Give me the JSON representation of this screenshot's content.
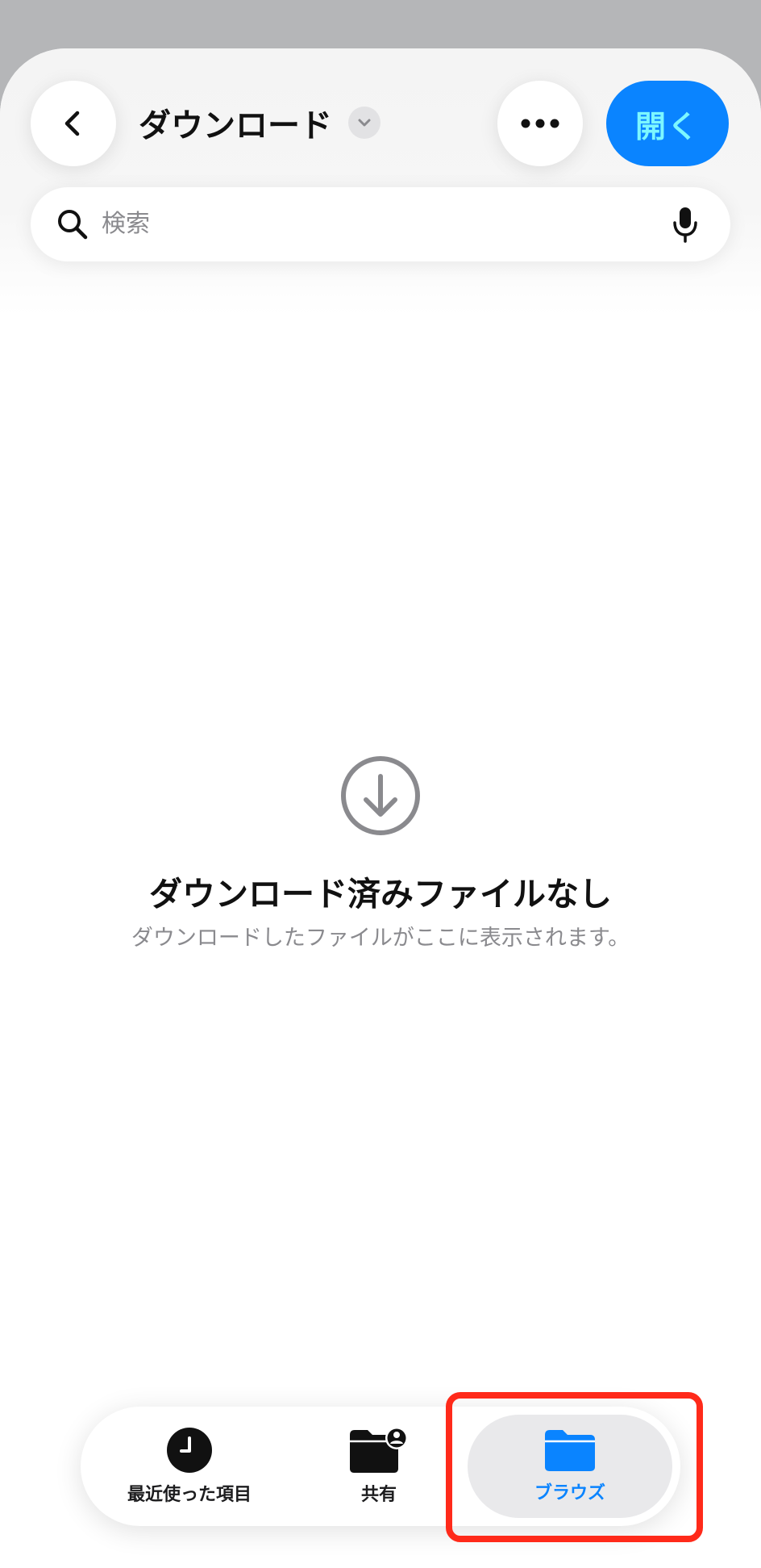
{
  "header": {
    "title": "ダウンロード",
    "open_button_label": "開く",
    "back_icon": "chevron-left-icon",
    "more_icon": "ellipsis-icon",
    "title_menu_icon": "chevron-down-icon"
  },
  "search": {
    "placeholder": "検索",
    "icon": "search-icon",
    "mic_icon": "microphone-icon"
  },
  "empty_state": {
    "icon": "download-circle-icon",
    "title": "ダウンロード済みファイルなし",
    "subtitle": "ダウンロードしたファイルがここに表示されます。"
  },
  "tabbar": {
    "items": [
      {
        "label": "最近使った項目",
        "icon": "clock-icon",
        "selected": false
      },
      {
        "label": "共有",
        "icon": "shared-folder-icon",
        "selected": false
      },
      {
        "label": "ブラウズ",
        "icon": "folder-icon",
        "selected": true
      }
    ]
  },
  "colors": {
    "accent": "#0a84ff",
    "open_button_text": "#7cf7ff",
    "highlight": "#ff2a1a",
    "secondary_text": "#8a8a8e"
  }
}
